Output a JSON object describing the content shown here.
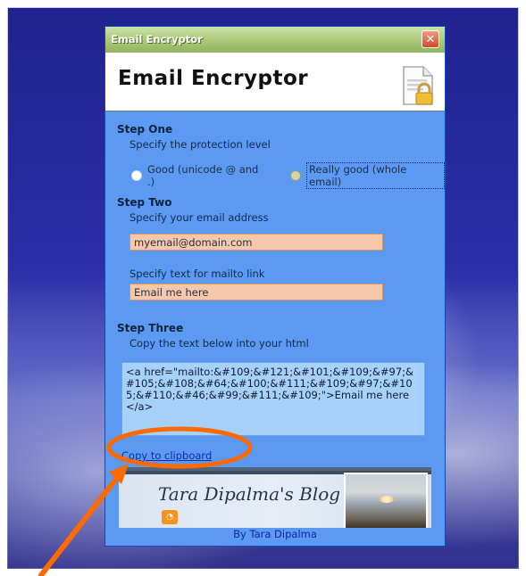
{
  "window": {
    "titlebar": "Email Encryptor",
    "header_title": "Email Encryptor"
  },
  "steps": {
    "one": {
      "title": "Step One",
      "subtitle": "Specify the protection level",
      "options": [
        {
          "label": "Good (unicode @ and .)",
          "checked": false
        },
        {
          "label": "Really good (whole email)",
          "checked": true
        }
      ]
    },
    "two": {
      "title": "Step Two",
      "email_label": "Specify your email address",
      "email_value": "myemail@domain.com",
      "link_label": "Specify text for mailto link",
      "link_value": "Email me here"
    },
    "three": {
      "title": "Step Three",
      "subtitle": "Copy the text below into your html",
      "output": "<a href=\"mailto:&#109;&#121;&#101;&#109;&#97;&#105;&#108;&#64;&#100;&#111;&#109;&#97;&#105;&#110;&#46;&#99;&#111;&#109;\">Email me here</a>"
    }
  },
  "copy_link": "Copy to clipboard",
  "blog": {
    "title": "Tara Dipalma's Blog"
  },
  "byline": "By Tara Dipalma",
  "colors": {
    "window_bg": "#5b99f2",
    "input_bg": "#f6c8a9",
    "textarea_bg": "#a6d1fb",
    "annotation": "#ff6a00"
  },
  "icons": {
    "close": "close-icon",
    "document": "document-lock-icon",
    "rss": "rss-icon"
  }
}
